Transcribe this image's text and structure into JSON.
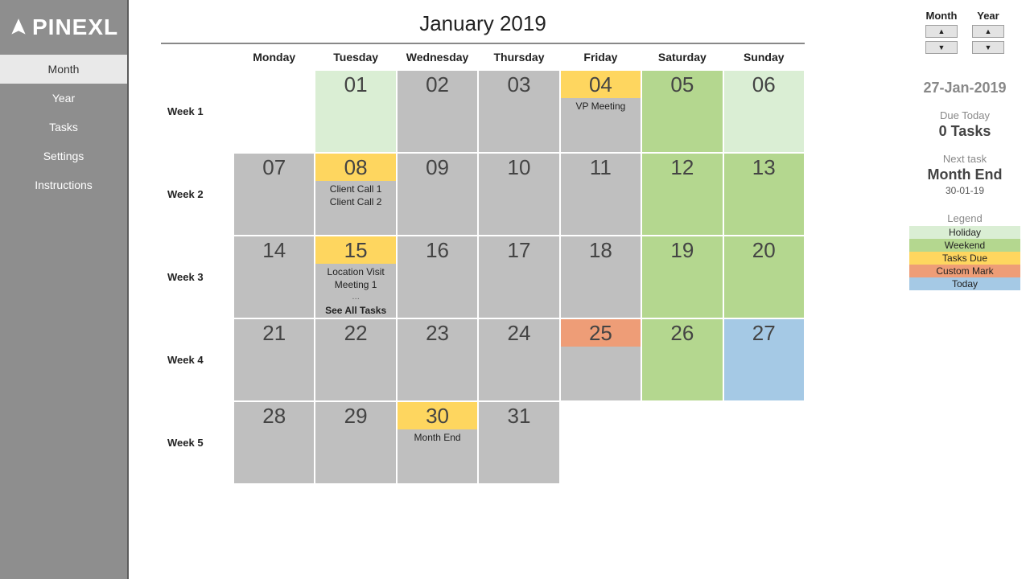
{
  "brand": "PINEXL",
  "nav": [
    "Month",
    "Year",
    "Tasks",
    "Settings",
    "Instructions"
  ],
  "navActive": 0,
  "title": "January 2019",
  "dayHeaders": [
    "Monday",
    "Tuesday",
    "Wednesday",
    "Thursday",
    "Friday",
    "Saturday",
    "Sunday"
  ],
  "weekLabels": [
    "Week 1",
    "Week 2",
    "Week 3",
    "Week 4",
    "Week 5"
  ],
  "grid": [
    [
      {
        "n": "",
        "type": "empty"
      },
      {
        "n": "01",
        "type": "holiday"
      },
      {
        "n": "02",
        "type": "default"
      },
      {
        "n": "03",
        "type": "default"
      },
      {
        "n": "04",
        "type": "tasks",
        "tasks": [
          "VP Meeting"
        ]
      },
      {
        "n": "05",
        "type": "weekend"
      },
      {
        "n": "06",
        "type": "holiday"
      }
    ],
    [
      {
        "n": "07",
        "type": "default"
      },
      {
        "n": "08",
        "type": "tasks",
        "tasks": [
          "Client Call 1",
          "Client Call 2"
        ]
      },
      {
        "n": "09",
        "type": "default"
      },
      {
        "n": "10",
        "type": "default"
      },
      {
        "n": "11",
        "type": "default"
      },
      {
        "n": "12",
        "type": "weekend"
      },
      {
        "n": "13",
        "type": "weekend"
      }
    ],
    [
      {
        "n": "14",
        "type": "default"
      },
      {
        "n": "15",
        "type": "tasks",
        "tasks": [
          "Location Visit",
          "Meeting 1"
        ],
        "more": true
      },
      {
        "n": "16",
        "type": "default"
      },
      {
        "n": "17",
        "type": "default"
      },
      {
        "n": "18",
        "type": "default"
      },
      {
        "n": "19",
        "type": "weekend"
      },
      {
        "n": "20",
        "type": "weekend"
      }
    ],
    [
      {
        "n": "21",
        "type": "default"
      },
      {
        "n": "22",
        "type": "default"
      },
      {
        "n": "23",
        "type": "default"
      },
      {
        "n": "24",
        "type": "default"
      },
      {
        "n": "25",
        "type": "custom"
      },
      {
        "n": "26",
        "type": "weekend"
      },
      {
        "n": "27",
        "type": "today"
      }
    ],
    [
      {
        "n": "28",
        "type": "default"
      },
      {
        "n": "29",
        "type": "default"
      },
      {
        "n": "30",
        "type": "tasks",
        "tasks": [
          "Month End"
        ]
      },
      {
        "n": "31",
        "type": "default"
      },
      {
        "n": "",
        "type": "empty"
      },
      {
        "n": "",
        "type": "empty"
      },
      {
        "n": "",
        "type": "empty"
      }
    ]
  ],
  "spinners": {
    "monthLabel": "Month",
    "yearLabel": "Year"
  },
  "todayDate": "27-Jan-2019",
  "dueToday": {
    "label": "Due Today",
    "value": "0 Tasks"
  },
  "nextTask": {
    "label": "Next task",
    "name": "Month End",
    "date": "30-01-19"
  },
  "seeAllLabel": "See All Tasks",
  "legend": {
    "label": "Legend",
    "items": [
      {
        "label": "Holiday",
        "class": "lg-holiday"
      },
      {
        "label": "Weekend",
        "class": "lg-weekend"
      },
      {
        "label": "Tasks Due",
        "class": "lg-tasks"
      },
      {
        "label": "Custom Mark",
        "class": "lg-custom"
      },
      {
        "label": "Today",
        "class": "lg-today"
      }
    ]
  }
}
